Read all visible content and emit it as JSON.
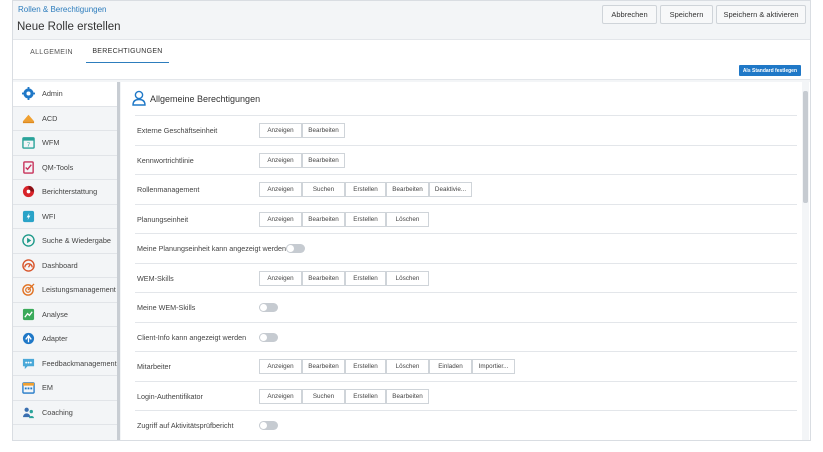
{
  "header": {
    "breadcrumb": "Rollen & Berechtigungen",
    "title": "Neue Rolle erstellen",
    "buttons": {
      "cancel": "Abbrechen",
      "save": "Speichern",
      "save_activate": "Speichern & aktivieren"
    }
  },
  "tabs": [
    {
      "label": "ALLGEMEIN",
      "active": false
    },
    {
      "label": "BERECHTIGUNGEN",
      "active": true
    }
  ],
  "toolbar": {
    "set_default": "Als Standard festlegen"
  },
  "sidebar": {
    "items": [
      {
        "label": "Admin",
        "icon": "gear-icon"
      },
      {
        "label": "ACD",
        "icon": "acd-icon"
      },
      {
        "label": "WFM",
        "icon": "calendar-icon"
      },
      {
        "label": "QM-Tools",
        "icon": "checklist-icon"
      },
      {
        "label": "Berichterstattung",
        "icon": "report-icon"
      },
      {
        "label": "WFI",
        "icon": "wfi-icon"
      },
      {
        "label": "Suche & Wiedergabe",
        "icon": "play-icon"
      },
      {
        "label": "Dashboard",
        "icon": "dashboard-icon"
      },
      {
        "label": "Leistungsmanagement",
        "icon": "target-icon"
      },
      {
        "label": "Analyse",
        "icon": "analytics-icon"
      },
      {
        "label": "Adapter",
        "icon": "adapter-icon"
      },
      {
        "label": "Feedbackmanagement",
        "icon": "feedback-icon"
      },
      {
        "label": "EM",
        "icon": "em-calendar-icon"
      },
      {
        "label": "Coaching",
        "icon": "coaching-icon"
      }
    ]
  },
  "section": {
    "title": "Allgemeine Berechtigungen",
    "icon": "user-icon"
  },
  "permissions": [
    {
      "label": "Externe Geschäftseinheit",
      "buttons": [
        "Anzeigen",
        "Bearbeiten"
      ]
    },
    {
      "label": "Kennwortrichtlinie",
      "buttons": [
        "Anzeigen",
        "Bearbeiten"
      ]
    },
    {
      "label": "Rollenmanagement",
      "buttons": [
        "Anzeigen",
        "Suchen",
        "Erstellen",
        "Bearbeiten",
        "Deaktivie..."
      ]
    },
    {
      "label": "Planungseinheit",
      "buttons": [
        "Anzeigen",
        "Bearbeiten",
        "Erstellen",
        "Löschen"
      ]
    },
    {
      "label": "Meine Planungseinheit kann angezeigt werden",
      "toggle": "off"
    },
    {
      "label": "WEM-Skills",
      "buttons": [
        "Anzeigen",
        "Bearbeiten",
        "Erstellen",
        "Löschen"
      ]
    },
    {
      "label": "Meine WEM-Skills",
      "toggle": "off"
    },
    {
      "label": "Client-Info kann angezeigt werden",
      "toggle": "off"
    },
    {
      "label": "Mitarbeiter",
      "buttons": [
        "Anzeigen",
        "Bearbeiten",
        "Erstellen",
        "Löschen",
        "Einladen",
        "Importier..."
      ]
    },
    {
      "label": "Login-Authentifikator",
      "buttons": [
        "Anzeigen",
        "Suchen",
        "Erstellen",
        "Bearbeiten"
      ]
    },
    {
      "label": "Zugriff auf Aktivitätsprüfbericht",
      "toggle": "off"
    }
  ],
  "colors": {
    "accent": "#2d7dbd",
    "primary_button": "#1f78c7",
    "toggle_off": "#c6cbd1"
  }
}
